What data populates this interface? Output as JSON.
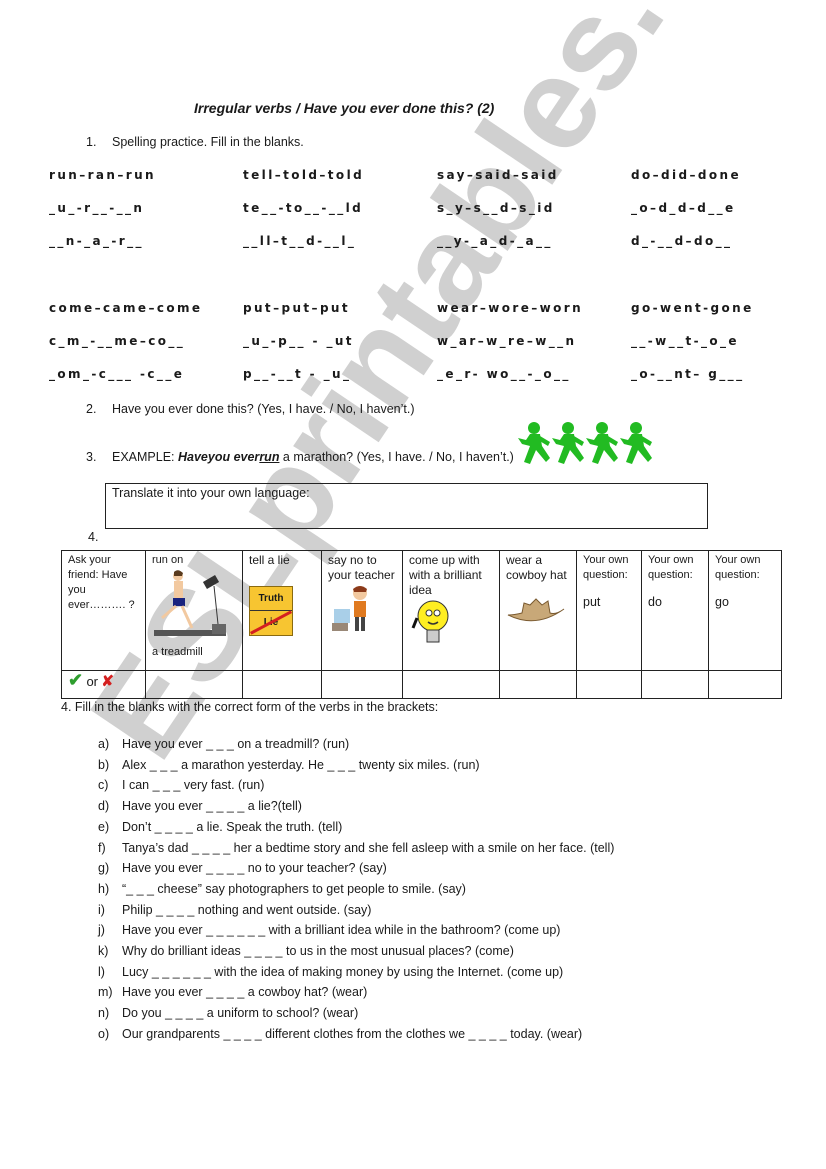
{
  "watermark": "ESLprintables.com",
  "title": "Irregular verbs / Have you ever done this? (2)",
  "section1": {
    "number": "1.",
    "instruction": "Spelling practice. Fill in the blanks.",
    "group1": [
      [
        "run–ran–run",
        "tell–told–told",
        "say–said–said",
        "do–did–done"
      ],
      [
        "_u_-r__-__n",
        "te__-to__-__ld",
        "s_y–s__d–s_id",
        "_o–d_d–d__e"
      ],
      [
        "__n-_a_-r__",
        "__ll–t__d-__l_",
        "__y-_a_d-_a__",
        "d_-__d–do__"
      ]
    ],
    "group2": [
      [
        "come–came–come",
        "put–put–put",
        "wear–wore–worn",
        "go-went-gone"
      ],
      [
        "c_m_-__me–co__",
        "_u_-p__ - _ut",
        "w_ar–w_re–w__n",
        "__-w__t-_o_e"
      ],
      [
        "_om_-c___ -c__e",
        "p__-__t - _u_",
        "_e_r- wo__-_o__",
        "_o-__nt– g___"
      ]
    ]
  },
  "section2": {
    "number": "2.",
    "text": "Have you ever done this? (Yes, I have. / No, I haven’t.)"
  },
  "section3": {
    "number": "3.",
    "prefix": "EXAMPLE: ",
    "bold_part": "Haveyou ever",
    "underlined": "run",
    "rest": " a marathon? (Yes, I have.  / No, I haven’t.)",
    "icon": "running-figures-icon",
    "translate_label": "Translate it into your own language:"
  },
  "section4_label": "4.",
  "table": {
    "headers": [
      "Ask your friend: Have you ever………. ?",
      "run on",
      "tell a lie",
      "say no to your teacher",
      "come up with with a brilliant idea",
      "wear a cowboy hat",
      "Your own question:",
      "Your own question:",
      "Your own question:"
    ],
    "own_question_verbs": [
      "put",
      "do",
      "go"
    ],
    "treadmill_caption": "a treadmill",
    "sign_top": "Truth",
    "sign_bottom": "Lie",
    "check_or_cross": "or"
  },
  "section4": {
    "instruction": "4. Fill in the blanks with the correct form of the verbs in the brackets:",
    "items": [
      {
        "label": "a)",
        "text": "Have you ever _ _ _ on a treadmill? (run)"
      },
      {
        "label": "b)",
        "text": "Alex _ _ _ a marathon yesterday. He _ _ _ twenty six miles. (run)"
      },
      {
        "label": "c)",
        "text": "I can _ _ _ very fast. (run)"
      },
      {
        "label": "d)",
        "text": "Have you ever _ _ _ _  a lie?(tell)"
      },
      {
        "label": "e)",
        "text": "Don’t _ _ _ _ a lie. Speak the truth. (tell)"
      },
      {
        "label": "f)",
        "text": "Tanya’s dad _ _ _ _ her  a bedtime story and she fell asleep with a smile on her face. (tell)"
      },
      {
        "label": "g)",
        "text": "Have you ever _ _ _ _ no to your teacher? (say)"
      },
      {
        "label": "h)",
        "text": "“_ _ _ cheese” say photographers to get people to smile. (say)"
      },
      {
        "label": "i)",
        "text": "Philip _ _ _ _ nothing and went outside. (say)"
      },
      {
        "label": "j)",
        "text": "Have you ever _ _ _ _  _ _ with a brilliant idea while in the bathroom? (come up)"
      },
      {
        "label": "k)",
        "text": "Why do brilliant ideas _ _ _ _ to us in the most unusual places?  (come)"
      },
      {
        "label": "l)",
        "text": "Lucy _ _ _ _  _ _ with the idea of making money by using the Internet. (come up)"
      },
      {
        "label": "m)",
        "text": "Have you ever _ _ _ _ a cowboy hat? (wear)"
      },
      {
        "label": "n)",
        "text": "Do you _ _ _ _ a uniform to school?  (wear)"
      },
      {
        "label": "o)",
        "text": "Our grandparents _ _ _ _ different clothes from the clothes we _ _ _ _ today. (wear)"
      }
    ]
  },
  "colors": {
    "watermark": "#c8c8c8",
    "runner_green": "#22bb22",
    "check_green": "#2e9e2e",
    "cross_red": "#d42020",
    "bulb_yellow": "#ffee22",
    "hat_tan": "#c8a878",
    "sign_orange": "#f7c531"
  }
}
